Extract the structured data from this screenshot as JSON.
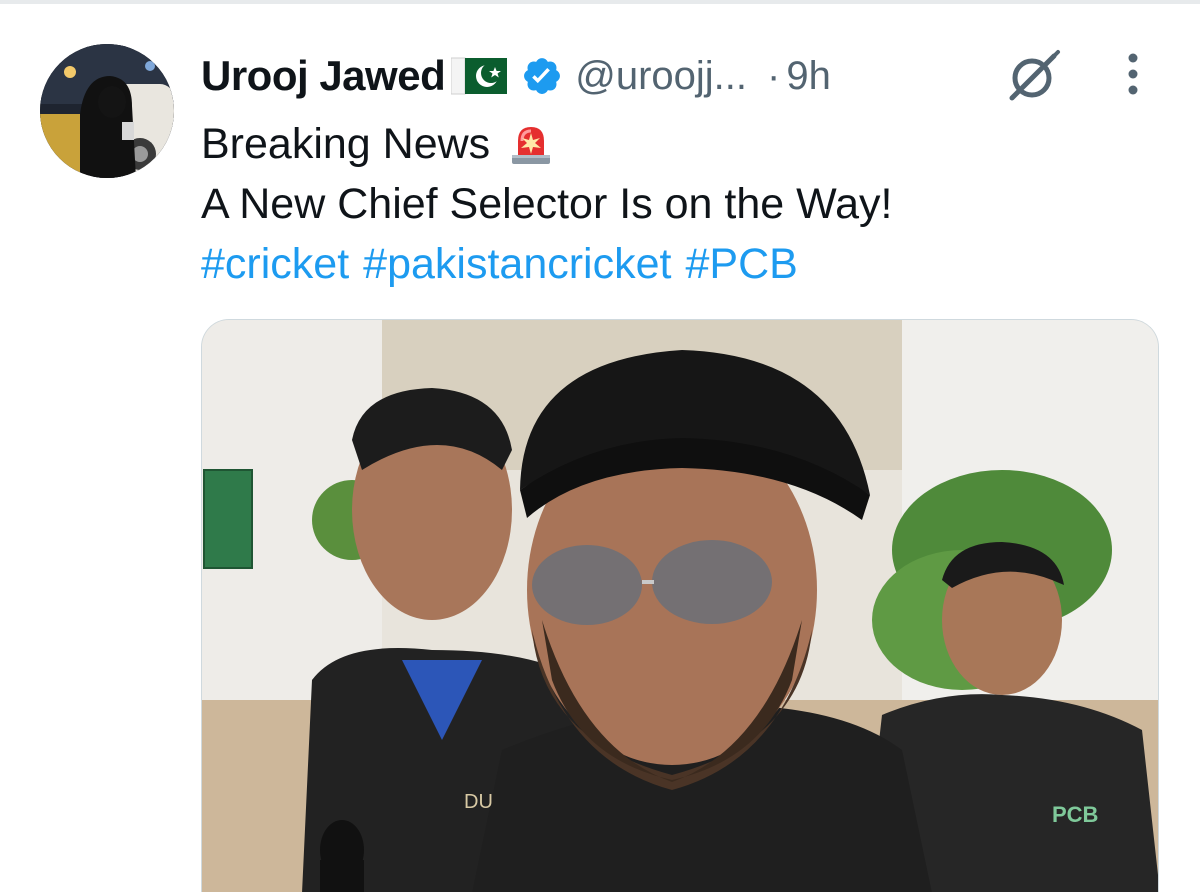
{
  "tweet": {
    "display_name": "Urooj Jawed",
    "handle": "@uroojj...",
    "separator": "·",
    "time": "9h",
    "line1": "Breaking News",
    "line2": "A New Chief Selector Is on the Way!",
    "hashtags": [
      "#cricket",
      "#pakistancricket",
      "#PCB"
    ]
  },
  "media": {
    "shirt_logo": "PCB",
    "jacket_text": "DU"
  },
  "icons": {
    "flag": "pakistan-flag-icon",
    "verified": "verified-badge-icon",
    "grok": "grok-icon",
    "more": "more-vertical-icon",
    "siren": "police-siren-icon"
  },
  "colors": {
    "text": "#0f1419",
    "secondary": "#536471",
    "link": "#1d9bf0",
    "verified": "#1d9bf0"
  }
}
